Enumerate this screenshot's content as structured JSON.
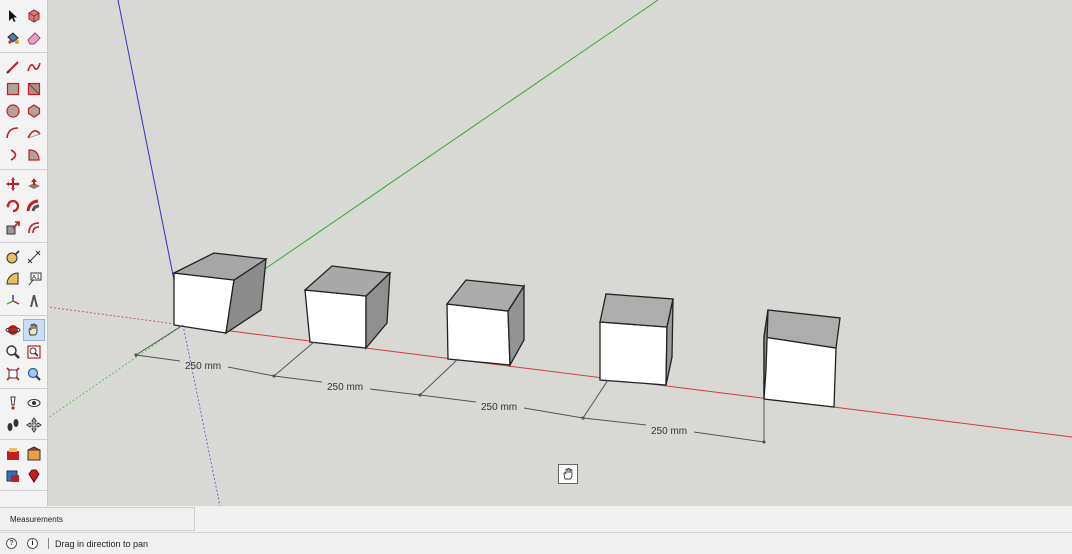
{
  "toolbar": {
    "groups": [
      {
        "name": "selection",
        "tools": [
          [
            "select-icon",
            "component-icon"
          ],
          [
            "paint-bucket-icon",
            "eraser-icon"
          ]
        ]
      },
      {
        "name": "drawing",
        "tools": [
          [
            "line-icon",
            "freehand-icon"
          ],
          [
            "rectangle-icon",
            "rotated-rectangle-icon"
          ],
          [
            "circle-icon",
            "polygon-icon"
          ],
          [
            "arc-icon",
            "two-point-arc-icon"
          ],
          [
            "three-point-arc-icon",
            "pie-icon"
          ]
        ]
      },
      {
        "name": "edit",
        "tools": [
          [
            "move-icon",
            "push-pull-icon"
          ],
          [
            "rotate-icon",
            "follow-me-icon"
          ],
          [
            "scale-icon",
            "offset-icon"
          ]
        ]
      },
      {
        "name": "construction",
        "tools": [
          [
            "tape-measure-icon",
            "dimension-icon"
          ],
          [
            "protractor-icon",
            "text-icon"
          ],
          [
            "axes-icon",
            "3d-text-icon"
          ]
        ]
      },
      {
        "name": "camera",
        "tools": [
          [
            "orbit-icon",
            "pan-icon"
          ],
          [
            "zoom-icon",
            "zoom-window-icon"
          ],
          [
            "zoom-extents-icon",
            "previous-view-icon"
          ]
        ]
      },
      {
        "name": "walkthrough",
        "tools": [
          [
            "position-camera-icon",
            "look-around-icon"
          ],
          [
            "walk-icon",
            "section-plane-icon"
          ]
        ]
      },
      {
        "name": "extensions",
        "tools": [
          [
            "extension-warehouse-icon",
            "3d-warehouse-icon"
          ],
          [
            "layout-icon",
            "ruby-icon"
          ]
        ]
      }
    ],
    "active_tool": "pan-icon"
  },
  "viewport": {
    "dimensions": [
      {
        "label": "250 mm"
      },
      {
        "label": "250 mm"
      },
      {
        "label": "250 mm"
      },
      {
        "label": "250 mm"
      }
    ],
    "axis_colors": {
      "red": "#d23c3c",
      "green": "#2fae2f",
      "blue": "#3232c8"
    },
    "background": "#d8d8d4"
  },
  "measurements": {
    "label": "Measurements"
  },
  "status": {
    "help_icon": "help-icon",
    "info_icon": "info-icon",
    "message": "Drag in direction to pan"
  }
}
